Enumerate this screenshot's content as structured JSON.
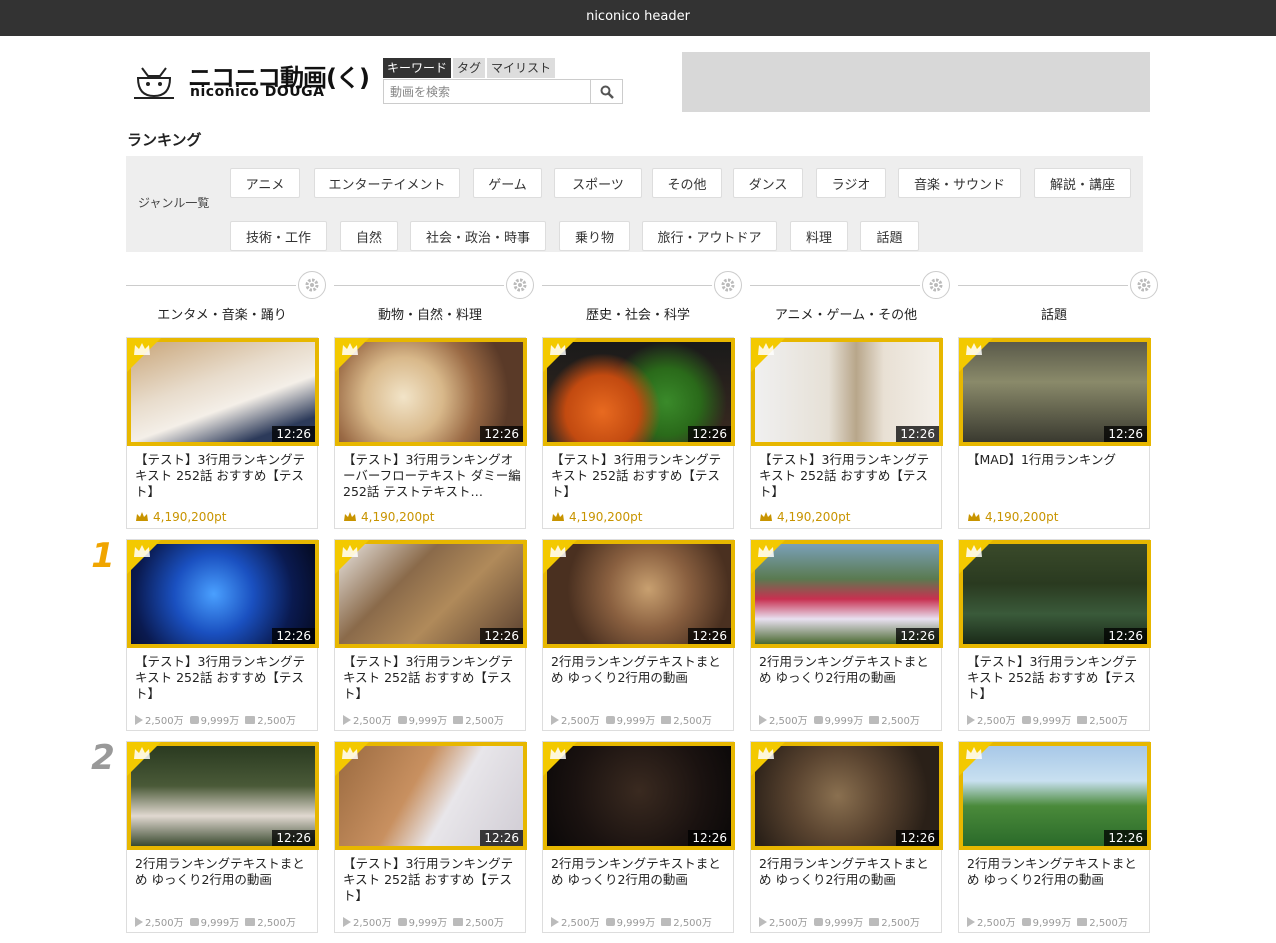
{
  "header": {
    "title": "niconico header"
  },
  "logo": {
    "jp": "ニコニコ動画(く)",
    "en": "niconico DOUGA"
  },
  "search": {
    "tabs": [
      "キーワード",
      "タグ",
      "マイリスト"
    ],
    "placeholder": "動画を検索"
  },
  "page_title": "ランキング",
  "genres": {
    "label": "ジャンル一覧",
    "items": [
      "アニメ",
      "エンターテイメント",
      "ゲーム",
      "スポーツ",
      "その他",
      "ダンス",
      "ラジオ",
      "音楽・サウンド",
      "解説・講座",
      "技術・工作",
      "自然",
      "社会・政治・時事",
      "乗り物",
      "旅行・アウトドア",
      "料理",
      "話題"
    ]
  },
  "columns": [
    "エンタメ・音楽・踊り",
    "動物・自然・料理",
    "歴史・社会・科学",
    "アニメ・ゲーム・その他",
    "話題"
  ],
  "ranks": [
    "1",
    "2"
  ],
  "rows": [
    [
      {
        "title": "【テスト】3行用ランキングテキスト 252話 おすすめ【テスト】",
        "duration": "12:26",
        "pts": "4,190,200pt",
        "img": "cat-cushion"
      },
      {
        "title": "【テスト】3行用ランキングオーバーフローテキスト ダミー編252話 テストテキスト…",
        "duration": "12:26",
        "pts": "4,190,200pt",
        "img": "dog-blur"
      },
      {
        "title": "【テスト】3行用ランキングテキスト 252話 おすすめ【テスト】",
        "duration": "12:26",
        "pts": "4,190,200pt",
        "img": "vegetables"
      },
      {
        "title": "【テスト】3行用ランキングテキスト 252話 おすすめ【テスト】",
        "duration": "12:26",
        "pts": "4,190,200pt",
        "img": "cat-post"
      },
      {
        "title": "【MAD】1行用ランキング",
        "duration": "12:26",
        "pts": "4,190,200pt",
        "img": "mecha"
      }
    ],
    [
      {
        "title": "【テスト】3行用ランキングテキスト 252話 おすすめ【テスト】",
        "duration": "12:26",
        "views": "2,500万",
        "comments": "9,999万",
        "mylists": "2,500万",
        "img": "blue-figure"
      },
      {
        "title": "【テスト】3行用ランキングテキスト 252話 おすすめ【テスト】",
        "duration": "12:26",
        "views": "2,500万",
        "comments": "9,999万",
        "mylists": "2,500万",
        "img": "cat-lying"
      },
      {
        "title": "2行用ランキングテキストまとめ ゆっくり2行用の動画",
        "duration": "12:26",
        "views": "2,500万",
        "comments": "9,999万",
        "mylists": "2,500万",
        "img": "cat-face"
      },
      {
        "title": "2行用ランキングテキストまとめ ゆっくり2行用の動画",
        "duration": "12:26",
        "views": "2,500万",
        "comments": "9,999万",
        "mylists": "2,500万",
        "img": "flowers"
      },
      {
        "title": "【テスト】3行用ランキングテキスト 252話 おすすめ【テスト】",
        "duration": "12:26",
        "views": "2,500万",
        "comments": "9,999万",
        "mylists": "2,500万",
        "img": "flamingos"
      }
    ],
    [
      {
        "title": "2行用ランキングテキストまとめ ゆっくり2行用の動画",
        "duration": "12:26",
        "views": "2,500万",
        "comments": "9,999万",
        "mylists": "2,500万",
        "img": "flamingos-garden"
      },
      {
        "title": "【テスト】3行用ランキングテキスト 252話 おすすめ【テスト】",
        "duration": "12:26",
        "views": "2,500万",
        "comments": "9,999万",
        "mylists": "2,500万",
        "img": "cat-pillow"
      },
      {
        "title": "2行用ランキングテキストまとめ ゆっくり2行用の動画",
        "duration": "12:26",
        "views": "2,500万",
        "comments": "9,999万",
        "mylists": "2,500万",
        "img": "grill"
      },
      {
        "title": "2行用ランキングテキストまとめ ゆっくり2行用の動画",
        "duration": "12:26",
        "views": "2,500万",
        "comments": "9,999万",
        "mylists": "2,500万",
        "img": "cat-collar"
      },
      {
        "title": "2行用ランキングテキストまとめ ゆっくり2行用の動画",
        "duration": "12:26",
        "views": "2,500万",
        "comments": "9,999万",
        "mylists": "2,500万",
        "img": "golf"
      }
    ]
  ],
  "colors": {
    "gold": "#e7b700",
    "rank1": "#f0a500",
    "rank2": "#999999",
    "header_bg": "#333333"
  }
}
